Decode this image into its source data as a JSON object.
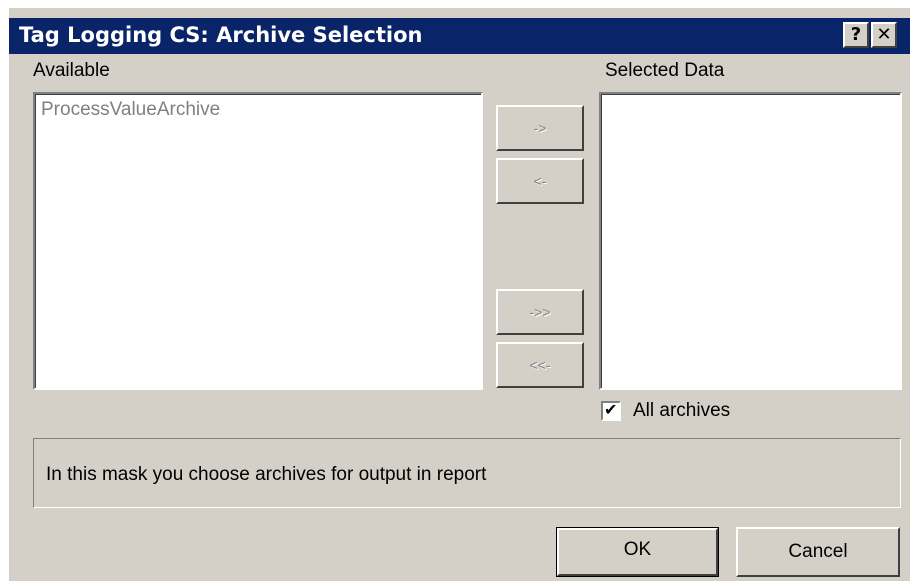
{
  "window": {
    "title": "Tag Logging CS: Archive Selection",
    "help_label": "?",
    "close_label": "✕"
  },
  "available": {
    "label": "Available",
    "items": [
      "ProcessValueArchive"
    ]
  },
  "selected": {
    "label": "Selected Data",
    "items": []
  },
  "transfer_buttons": {
    "add": "->",
    "remove": "<-",
    "add_all": "->>",
    "remove_all": "<<-"
  },
  "all_archives": {
    "label": "All archives",
    "checked": true,
    "check_mark": "✔"
  },
  "info": {
    "text": "In this mask you choose archives for output in report"
  },
  "footer": {
    "ok_label": "OK",
    "cancel_label": "Cancel"
  }
}
